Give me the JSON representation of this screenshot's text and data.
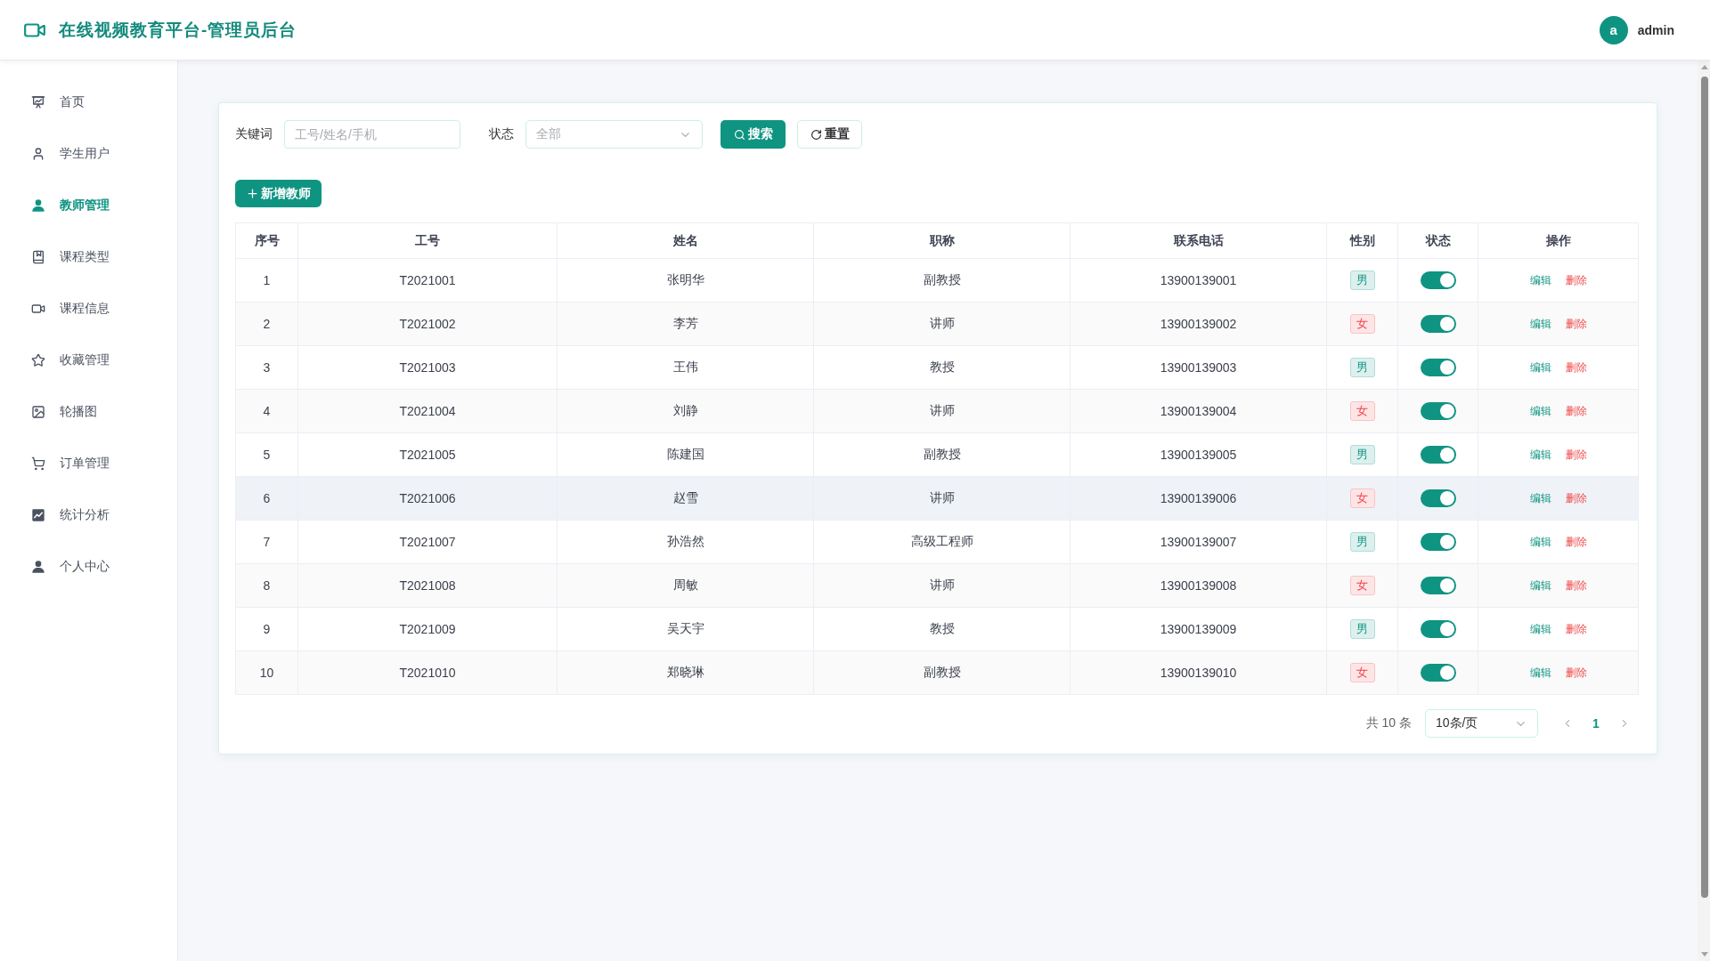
{
  "header": {
    "title": "在线视频教育平台-管理员后台",
    "user": {
      "avatar_letter": "a",
      "name": "admin"
    }
  },
  "sidebar": {
    "items": [
      {
        "label": "首页",
        "selected": false
      },
      {
        "label": "学生用户",
        "selected": false
      },
      {
        "label": "教师管理",
        "selected": true
      },
      {
        "label": "课程类型",
        "selected": false
      },
      {
        "label": "课程信息",
        "selected": false
      },
      {
        "label": "收藏管理",
        "selected": false
      },
      {
        "label": "轮播图",
        "selected": false
      },
      {
        "label": "订单管理",
        "selected": false
      },
      {
        "label": "统计分析",
        "selected": false
      },
      {
        "label": "个人中心",
        "selected": false
      }
    ]
  },
  "filters": {
    "keyword": {
      "label": "关键词",
      "placeholder": "工号/姓名/手机"
    },
    "status": {
      "label": "状态",
      "placeholder": "全部"
    },
    "buttons": [
      {
        "label": "搜索",
        "kind": "search"
      },
      {
        "label": "重置",
        "kind": "reset"
      }
    ]
  },
  "add_button": "新增教师",
  "table": {
    "columns": [
      "序号",
      "工号",
      "姓名",
      "职称",
      "联系电话",
      "性别",
      "状态",
      "操作"
    ],
    "rows": [
      {
        "index": "1",
        "staff_no": "T2021001",
        "name": "张明华",
        "rank": "副教授",
        "phone": "13900139001",
        "gender": {
          "label": "男",
          "color": "#0f9482"
        },
        "on": true,
        "highlighted": false,
        "actions": [
          {
            "label": "编辑",
            "kind": "edit"
          },
          {
            "label": "删除",
            "kind": "delete"
          }
        ]
      },
      {
        "index": "2",
        "staff_no": "T2021002",
        "name": "李芳",
        "rank": "讲师",
        "phone": "13900139002",
        "gender": {
          "label": "女",
          "color": "#f0454a"
        },
        "on": true,
        "highlighted": false,
        "actions": [
          {
            "label": "编辑",
            "kind": "edit"
          },
          {
            "label": "删除",
            "kind": "delete"
          }
        ]
      },
      {
        "index": "3",
        "staff_no": "T2021003",
        "name": "王伟",
        "rank": "教授",
        "phone": "13900139003",
        "gender": {
          "label": "男",
          "color": "#0f9482"
        },
        "on": true,
        "highlighted": false,
        "actions": [
          {
            "label": "编辑",
            "kind": "edit"
          },
          {
            "label": "删除",
            "kind": "delete"
          }
        ]
      },
      {
        "index": "4",
        "staff_no": "T2021004",
        "name": "刘静",
        "rank": "讲师",
        "phone": "13900139004",
        "gender": {
          "label": "女",
          "color": "#f0454a"
        },
        "on": true,
        "highlighted": false,
        "actions": [
          {
            "label": "编辑",
            "kind": "edit"
          },
          {
            "label": "删除",
            "kind": "delete"
          }
        ]
      },
      {
        "index": "5",
        "staff_no": "T2021005",
        "name": "陈建国",
        "rank": "副教授",
        "phone": "13900139005",
        "gender": {
          "label": "男",
          "color": "#0f9482"
        },
        "on": true,
        "highlighted": false,
        "actions": [
          {
            "label": "编辑",
            "kind": "edit"
          },
          {
            "label": "删除",
            "kind": "delete"
          }
        ]
      },
      {
        "index": "6",
        "staff_no": "T2021006",
        "name": "赵雪",
        "rank": "讲师",
        "phone": "13900139006",
        "gender": {
          "label": "女",
          "color": "#f0454a"
        },
        "on": true,
        "highlighted": true,
        "actions": [
          {
            "label": "编辑",
            "kind": "edit"
          },
          {
            "label": "删除",
            "kind": "delete"
          }
        ]
      },
      {
        "index": "7",
        "staff_no": "T2021007",
        "name": "孙浩然",
        "rank": "高级工程师",
        "phone": "13900139007",
        "gender": {
          "label": "男",
          "color": "#0f9482"
        },
        "on": true,
        "highlighted": false,
        "actions": [
          {
            "label": "编辑",
            "kind": "edit"
          },
          {
            "label": "删除",
            "kind": "delete"
          }
        ]
      },
      {
        "index": "8",
        "staff_no": "T2021008",
        "name": "周敏",
        "rank": "讲师",
        "phone": "13900139008",
        "gender": {
          "label": "女",
          "color": "#f0454a"
        },
        "on": true,
        "highlighted": false,
        "actions": [
          {
            "label": "编辑",
            "kind": "edit"
          },
          {
            "label": "删除",
            "kind": "delete"
          }
        ]
      },
      {
        "index": "9",
        "staff_no": "T2021009",
        "name": "吴天宇",
        "rank": "教授",
        "phone": "13900139009",
        "gender": {
          "label": "男",
          "color": "#0f9482"
        },
        "on": true,
        "highlighted": false,
        "actions": [
          {
            "label": "编辑",
            "kind": "edit"
          },
          {
            "label": "删除",
            "kind": "delete"
          }
        ]
      },
      {
        "index": "10",
        "staff_no": "T2021010",
        "name": "郑晓琳",
        "rank": "副教授",
        "phone": "13900139010",
        "gender": {
          "label": "女",
          "color": "#f0454a"
        },
        "on": true,
        "highlighted": false,
        "actions": [
          {
            "label": "编辑",
            "kind": "edit"
          },
          {
            "label": "删除",
            "kind": "delete"
          }
        ]
      }
    ]
  },
  "pagination": {
    "total": "共 10 条",
    "page_size": "10条/页",
    "pages": [
      {
        "label": "1",
        "selected": true
      }
    ]
  }
}
